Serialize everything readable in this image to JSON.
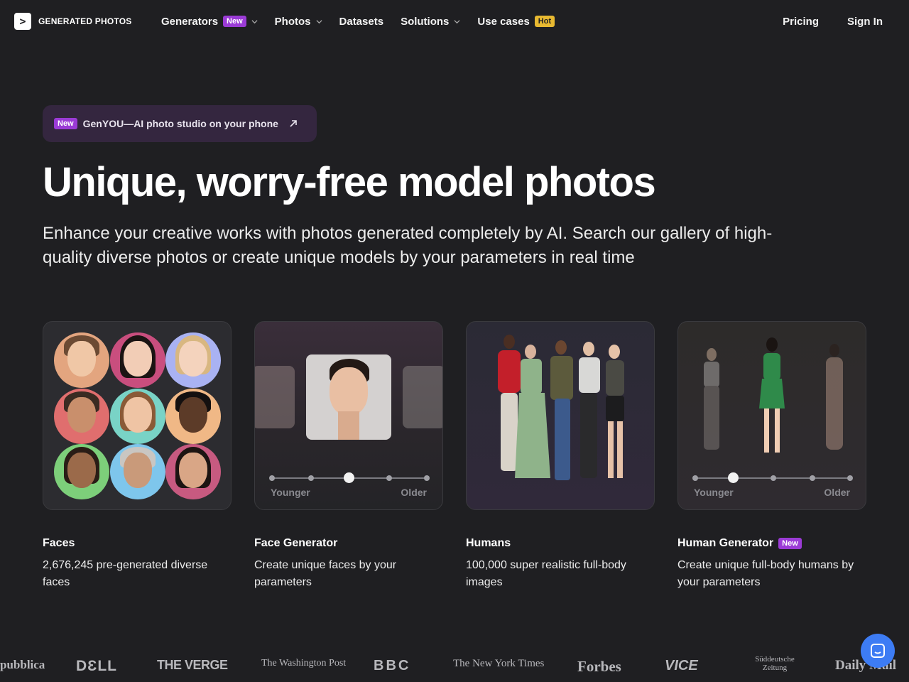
{
  "brand": {
    "logo_glyph": ">",
    "name": "GENERATED PHOTOS"
  },
  "nav": {
    "items": [
      {
        "label": "Generators",
        "badge": "New",
        "has_dropdown": true
      },
      {
        "label": "Photos",
        "has_dropdown": true
      },
      {
        "label": "Datasets",
        "has_dropdown": false
      },
      {
        "label": "Solutions",
        "has_dropdown": true
      },
      {
        "label": "Use cases",
        "badge": "Hot",
        "has_dropdown": false
      }
    ],
    "pricing": "Pricing",
    "sign_in": "Sign In"
  },
  "promo": {
    "badge": "New",
    "text": "GenYOU—AI photo studio on your phone",
    "icon": "arrow-up-right-icon"
  },
  "hero": {
    "title": "Unique, worry-free model photos",
    "lead": "Enhance your creative works with photos generated completely by AI. Search our gallery of high-quality diverse photos or create unique models by your parameters in real time"
  },
  "cards": [
    {
      "title": "Faces",
      "desc": "2,676,245 pre-generated diverse faces"
    },
    {
      "title": "Face Generator",
      "desc": "Create unique faces by your parameters",
      "slider": {
        "min_label": "Younger",
        "max_label": "Older",
        "steps": 5,
        "value_step": 3
      }
    },
    {
      "title": "Humans",
      "desc": "100,000 super realistic full-body images"
    },
    {
      "title": "Human Generator",
      "badge": "New",
      "desc": "Create unique full-body humans by your parameters",
      "slider": {
        "min_label": "Younger",
        "max_label": "Older",
        "steps": 5,
        "value_step": 2
      }
    }
  ],
  "press_logos": [
    "pubblica",
    "DƐLL",
    "THE VERGE",
    "The Washington Post",
    "BBC",
    "The New York Times",
    "Forbes",
    "VICE",
    "Süddeutsche Zeitung",
    "Daily Mail"
  ],
  "colors": {
    "background": "#1f1f22",
    "badge_new": "#9b3bd6",
    "badge_hot": "#e8b931",
    "chat_button": "#3d7cf4"
  },
  "chat": {
    "icon": "chat-icon"
  }
}
